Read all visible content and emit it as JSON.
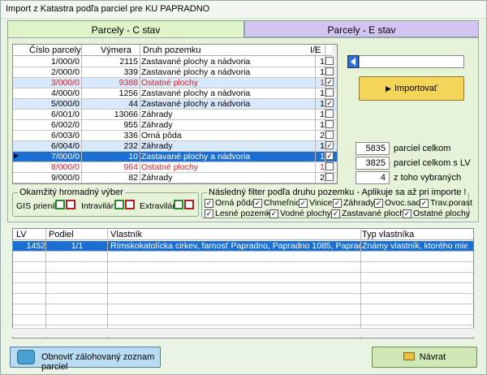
{
  "window": {
    "title": "Import z  Katastra podľa parciel pre KU  PAPRADNO"
  },
  "tabs": [
    {
      "label": "Parcely  - C stav",
      "active": true
    },
    {
      "label": "Parcely  - E stav",
      "active": false
    }
  ],
  "parcel_table": {
    "headers": {
      "cislo": "Číslo parcely",
      "vymera": "Výmera",
      "druh": "Druh pozemku",
      "ie": "I/E"
    },
    "rows": [
      {
        "cislo": "1/000/0",
        "vymera": "2115",
        "druh": "Zastavané plochy a nádvoria",
        "ie": "1",
        "checked": false,
        "style": "normal"
      },
      {
        "cislo": "2/000/0",
        "vymera": "339",
        "druh": "Zastavané plochy a nádvoria",
        "ie": "1",
        "checked": false,
        "style": "normal"
      },
      {
        "cislo": "3/000/0",
        "vymera": "9388",
        "druh": "Ostatné plochy",
        "ie": "1",
        "checked": true,
        "style": "red-hl"
      },
      {
        "cislo": "4/000/0",
        "vymera": "1256",
        "druh": "Zastavané plochy a nádvoria",
        "ie": "1",
        "checked": false,
        "style": "normal"
      },
      {
        "cislo": "5/000/0",
        "vymera": "44",
        "druh": "Zastavané plochy a nádvoria",
        "ie": "1",
        "checked": true,
        "style": "hl"
      },
      {
        "cislo": "6/001/0",
        "vymera": "13066",
        "druh": "Záhrady",
        "ie": "1",
        "checked": false,
        "style": "normal"
      },
      {
        "cislo": "6/002/0",
        "vymera": "955",
        "druh": "Záhrady",
        "ie": "1",
        "checked": false,
        "style": "normal"
      },
      {
        "cislo": "6/003/0",
        "vymera": "336",
        "druh": "Orná pôda",
        "ie": "2",
        "checked": false,
        "style": "normal"
      },
      {
        "cislo": "6/004/0",
        "vymera": "232",
        "druh": "Záhrady",
        "ie": "1",
        "checked": true,
        "style": "hl"
      },
      {
        "cislo": "7/000/0",
        "vymera": "10",
        "druh": "Zastavané plochy a nádvoria",
        "ie": "1",
        "checked": true,
        "style": "sel"
      },
      {
        "cislo": "8/000/0",
        "vymera": "964",
        "druh": "Ostatné plochy",
        "ie": "1",
        "checked": false,
        "style": "red"
      },
      {
        "cislo": "9/000/0",
        "vymera": "82",
        "druh": "Záhrady",
        "ie": "2",
        "checked": false,
        "style": "normal"
      }
    ]
  },
  "import_button": {
    "label": "Importovať"
  },
  "stats": {
    "total": {
      "value": "5835",
      "label": "parciel celkom"
    },
    "with_lv": {
      "value": "3825",
      "label": "parciel celkom s LV"
    },
    "selected": {
      "value": "4",
      "label": "z toho vybraných"
    }
  },
  "quick_select": {
    "title": "Okamžitý hromadný výber",
    "gis": "GIS prienik:",
    "intravilan": "Intravilán:",
    "extravilan": "Extravilán:"
  },
  "filter": {
    "title": "Následný filter podľa druhu pozemku - Aplikuje sa až pri importe !",
    "items": [
      "Orná pôda",
      "Chmeľnice",
      "Vinice",
      "Záhrady",
      "Ovoc.sady",
      "Trav.porast",
      "Lesné pozemky",
      "Vodné plochy",
      "Zastavané plochy",
      "Ostatné plochy"
    ]
  },
  "owners_table": {
    "headers": {
      "lv": "LV",
      "podiel": "Podiel",
      "vlastnik": "Vlastník",
      "typ": "Typ vlastníka"
    },
    "rows": [
      {
        "lv": "1452",
        "podiel": "1/1",
        "vlastnik": "Rímskokatolícka cirkev, farnosť Papradno, Papradno 1085, Papradno, PSČ 01",
        "typ": "Známy vlastník, ktorého miesto"
      }
    ]
  },
  "refresh_button": {
    "label": "Obnoviť  zálohovaný zoznam parciel"
  },
  "back_button": {
    "label": "Návrat"
  }
}
